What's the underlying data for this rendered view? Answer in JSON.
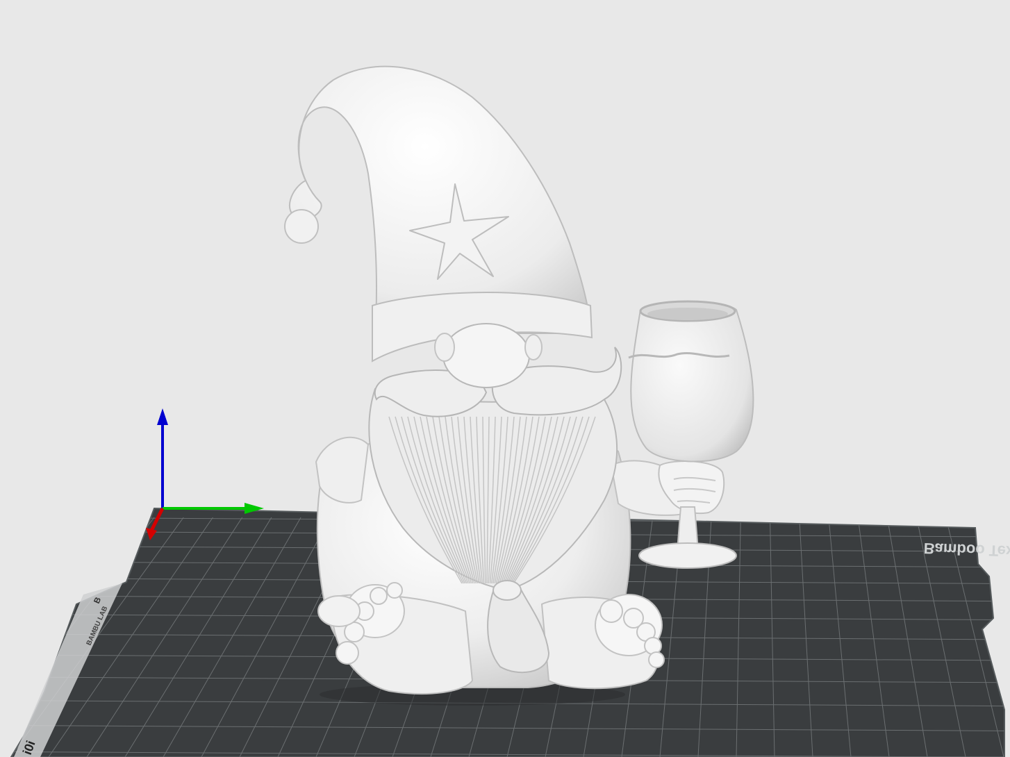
{
  "viewport": {
    "background": "#e8e8e8"
  },
  "build_plate": {
    "surface_color": "#3a3d3f",
    "grid_color": "#6b6f71",
    "edge_color": "#555a5c",
    "label": "Bamboo Textured PEI",
    "side_label_top": "B",
    "side_label_main": "BAMBU LAB",
    "side_label_bottom": "i0i"
  },
  "axes": {
    "x_color": "#00c800",
    "y_color": "#d40000",
    "z_color": "#0000d0"
  },
  "model": {
    "name": "gnome-with-wine-glass",
    "color": "#f4f4f4",
    "shadow_color": "#cfcfcf",
    "emblem": "starfish-icon"
  }
}
